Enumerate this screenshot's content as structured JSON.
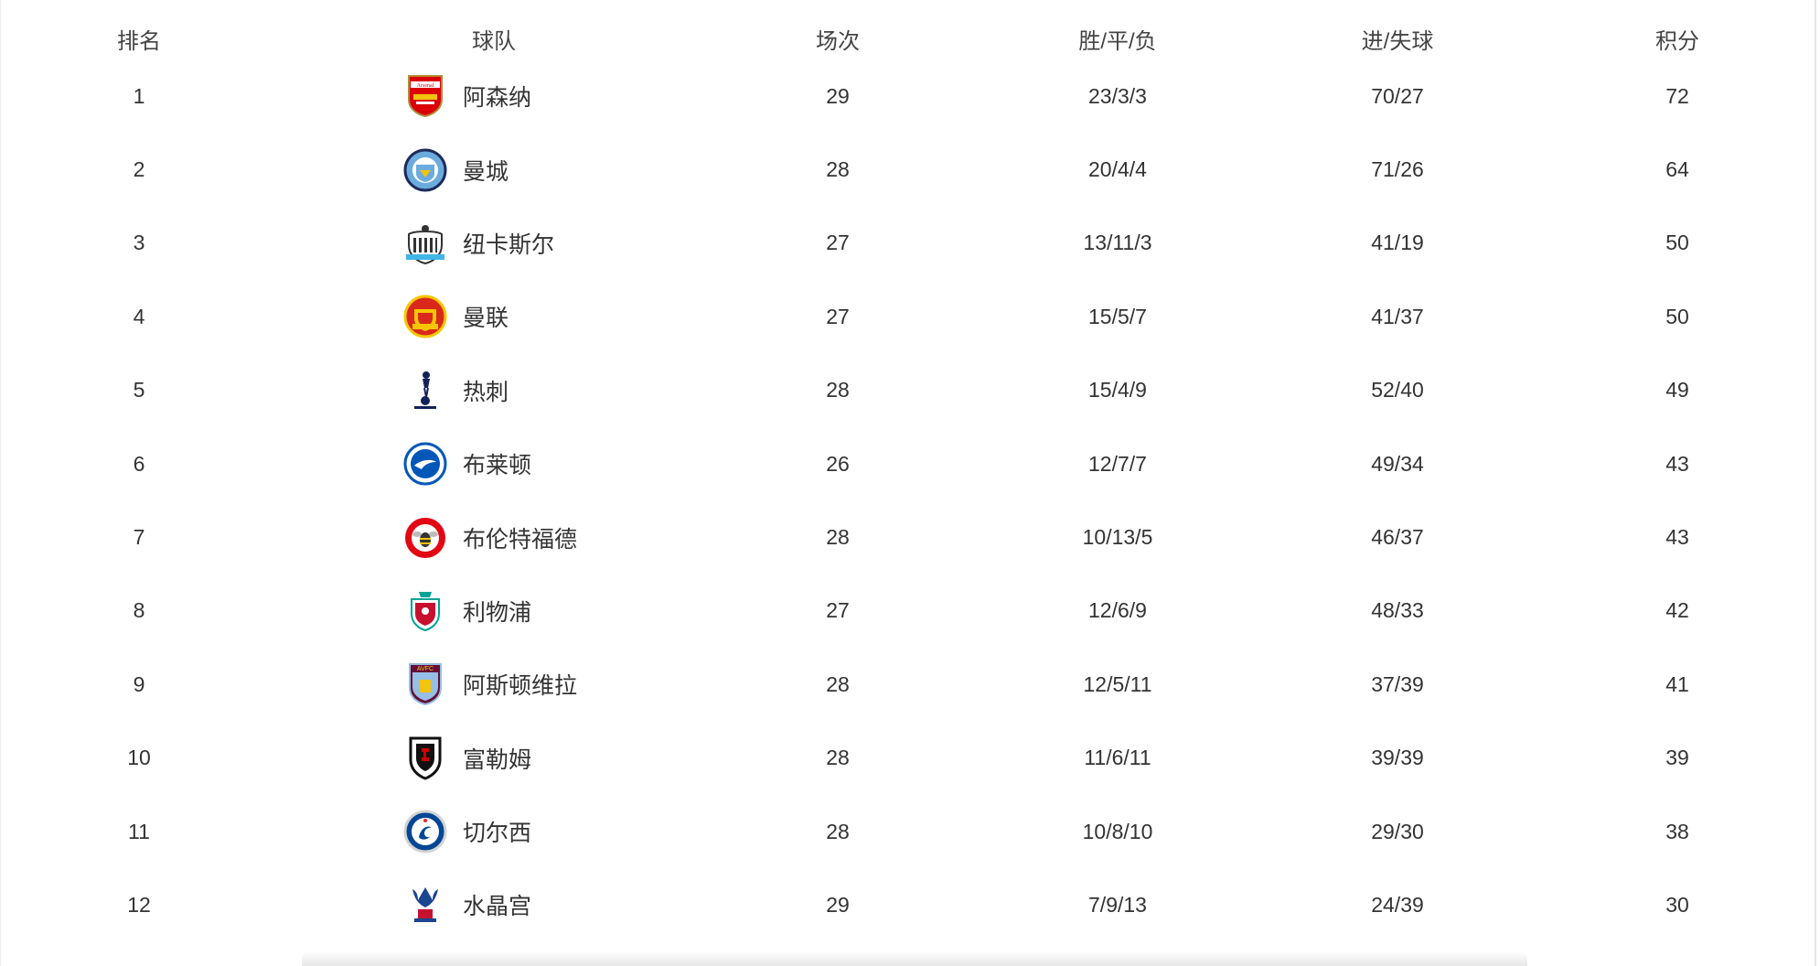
{
  "headers": {
    "rank": "排名",
    "team": "球队",
    "played": "场次",
    "wdl": "胜/平/负",
    "gfga": "进/失球",
    "points": "积分"
  },
  "rows": [
    {
      "rank": "1",
      "team": "阿森纳",
      "played": "29",
      "wdl": "23/3/3",
      "gfga": "70/27",
      "points": "72",
      "logo_icon": "arsenal-crest-icon"
    },
    {
      "rank": "2",
      "team": "曼城",
      "played": "28",
      "wdl": "20/4/4",
      "gfga": "71/26",
      "points": "64",
      "logo_icon": "manchester-city-crest-icon"
    },
    {
      "rank": "3",
      "team": "纽卡斯尔",
      "played": "27",
      "wdl": "13/11/3",
      "gfga": "41/19",
      "points": "50",
      "logo_icon": "newcastle-crest-icon"
    },
    {
      "rank": "4",
      "team": "曼联",
      "played": "27",
      "wdl": "15/5/7",
      "gfga": "41/37",
      "points": "50",
      "logo_icon": "manchester-united-crest-icon"
    },
    {
      "rank": "5",
      "team": "热刺",
      "played": "28",
      "wdl": "15/4/9",
      "gfga": "52/40",
      "points": "49",
      "logo_icon": "tottenham-crest-icon"
    },
    {
      "rank": "6",
      "team": "布莱顿",
      "played": "26",
      "wdl": "12/7/7",
      "gfga": "49/34",
      "points": "43",
      "logo_icon": "brighton-crest-icon"
    },
    {
      "rank": "7",
      "team": "布伦特福德",
      "played": "28",
      "wdl": "10/13/5",
      "gfga": "46/37",
      "points": "43",
      "logo_icon": "brentford-crest-icon"
    },
    {
      "rank": "8",
      "team": "利物浦",
      "played": "27",
      "wdl": "12/6/9",
      "gfga": "48/33",
      "points": "42",
      "logo_icon": "liverpool-crest-icon"
    },
    {
      "rank": "9",
      "team": "阿斯顿维拉",
      "played": "28",
      "wdl": "12/5/11",
      "gfga": "37/39",
      "points": "41",
      "logo_icon": "aston-villa-crest-icon"
    },
    {
      "rank": "10",
      "team": "富勒姆",
      "played": "28",
      "wdl": "11/6/11",
      "gfga": "39/39",
      "points": "39",
      "logo_icon": "fulham-crest-icon"
    },
    {
      "rank": "11",
      "team": "切尔西",
      "played": "28",
      "wdl": "10/8/10",
      "gfga": "29/30",
      "points": "38",
      "logo_icon": "chelsea-crest-icon"
    },
    {
      "rank": "12",
      "team": "水晶宫",
      "played": "29",
      "wdl": "7/9/13",
      "gfga": "24/39",
      "points": "30",
      "logo_icon": "crystal-palace-crest-icon"
    }
  ],
  "colors": {
    "arsenal": "#DB0007",
    "man_city": "#6CABDD",
    "man_utd": "#DA291C",
    "tottenham": "#132257",
    "brighton": "#0057B8",
    "brentford": "#E30613",
    "liverpool": "#C8102E",
    "aston_villa": "#95BFE5",
    "chelsea": "#034694",
    "crystal_palace": "#1B458F"
  }
}
